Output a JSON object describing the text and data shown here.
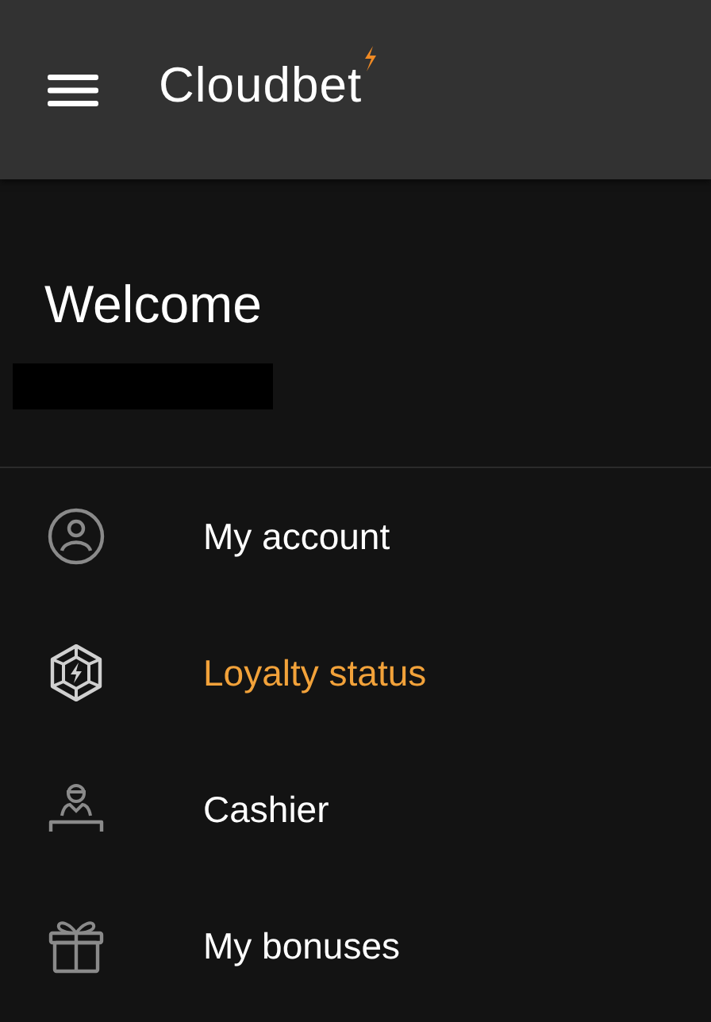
{
  "header": {
    "logo": "Cloudbet"
  },
  "welcome": {
    "title": "Welcome"
  },
  "menu": [
    {
      "kind": "account",
      "label": "My account",
      "selected": false
    },
    {
      "kind": "loyalty",
      "label": "Loyalty status",
      "selected": true
    },
    {
      "kind": "cashier",
      "label": "Cashier",
      "selected": false
    },
    {
      "kind": "bonuses",
      "label": "My bonuses",
      "selected": false
    }
  ]
}
